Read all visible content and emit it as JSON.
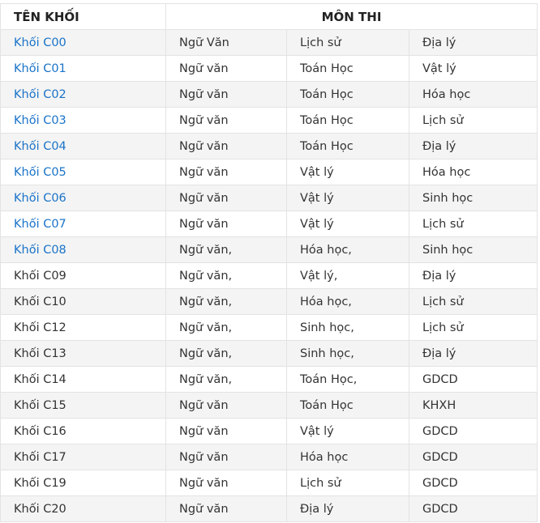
{
  "header": {
    "col_ten_khoi": "TÊN KHỐI",
    "col_mon_thi": "MÔN THI"
  },
  "colors": {
    "link": "#1a73c8",
    "text": "#333333",
    "stripe": "#f4f4f4",
    "border": "#e3e3e3"
  },
  "rows": [
    {
      "khoi": "Khối C00",
      "link": true,
      "mon": [
        "Ngữ Văn",
        "Lịch sử",
        " Địa lý"
      ]
    },
    {
      "khoi": "Khối C01",
      "link": true,
      "mon": [
        "Ngữ văn",
        "Toán Học",
        "Vật lý"
      ]
    },
    {
      "khoi": "Khối C02",
      "link": true,
      "mon": [
        "Ngữ văn",
        "Toán Học",
        " Hóa học"
      ]
    },
    {
      "khoi": "Khối C03",
      "link": true,
      "mon": [
        "Ngữ văn",
        "Toán Học",
        "Lịch sử"
      ]
    },
    {
      "khoi": "Khối C04",
      "link": true,
      "mon": [
        "Ngữ văn",
        "Toán Học",
        "Địa lý"
      ]
    },
    {
      "khoi": "Khối C05",
      "link": true,
      "mon": [
        "Ngữ văn",
        "Vật lý",
        "Hóa học"
      ]
    },
    {
      "khoi": "Khối C06",
      "link": true,
      "mon": [
        "Ngữ văn",
        "Vật lý",
        "Sinh học"
      ]
    },
    {
      "khoi": "Khối C07",
      "link": true,
      "mon": [
        "Ngữ văn",
        "Vật lý",
        "Lịch sử"
      ]
    },
    {
      "khoi": "Khối C08",
      "link": true,
      "mon": [
        "Ngữ văn,",
        "Hóa học,",
        "Sinh học"
      ]
    },
    {
      "khoi": "Khối C09",
      "link": false,
      "mon": [
        "Ngữ văn,",
        "Vật lý,",
        "Địa lý"
      ]
    },
    {
      "khoi": "Khối C10",
      "link": false,
      "mon": [
        "Ngữ văn,",
        "Hóa học,",
        " Lịch sử"
      ]
    },
    {
      "khoi": "Khối C12",
      "link": false,
      "mon": [
        "Ngữ văn,",
        "Sinh học,",
        " Lịch sử"
      ]
    },
    {
      "khoi": "Khối C13",
      "link": false,
      "mon": [
        "Ngữ văn,",
        "Sinh học,",
        " Địa lý"
      ]
    },
    {
      "khoi": "Khối C14",
      "link": false,
      "mon": [
        "Ngữ văn,",
        "Toán Học,",
        "GDCD"
      ]
    },
    {
      "khoi": "Khối C15",
      "link": false,
      "mon": [
        "Ngữ văn",
        "Toán Học",
        "KHXH"
      ]
    },
    {
      "khoi": "Khối C16",
      "link": false,
      "mon": [
        "Ngữ văn",
        "Vật lý",
        "GDCD"
      ]
    },
    {
      "khoi": "Khối C17",
      "link": false,
      "mon": [
        "Ngữ văn",
        "Hóa học",
        "GDCD"
      ]
    },
    {
      "khoi": "Khối C19",
      "link": false,
      "mon": [
        "Ngữ văn",
        "Lịch sử",
        "GDCD"
      ]
    },
    {
      "khoi": "Khối C20",
      "link": false,
      "mon": [
        "Ngữ văn",
        " Địa lý",
        "GDCD"
      ]
    }
  ]
}
